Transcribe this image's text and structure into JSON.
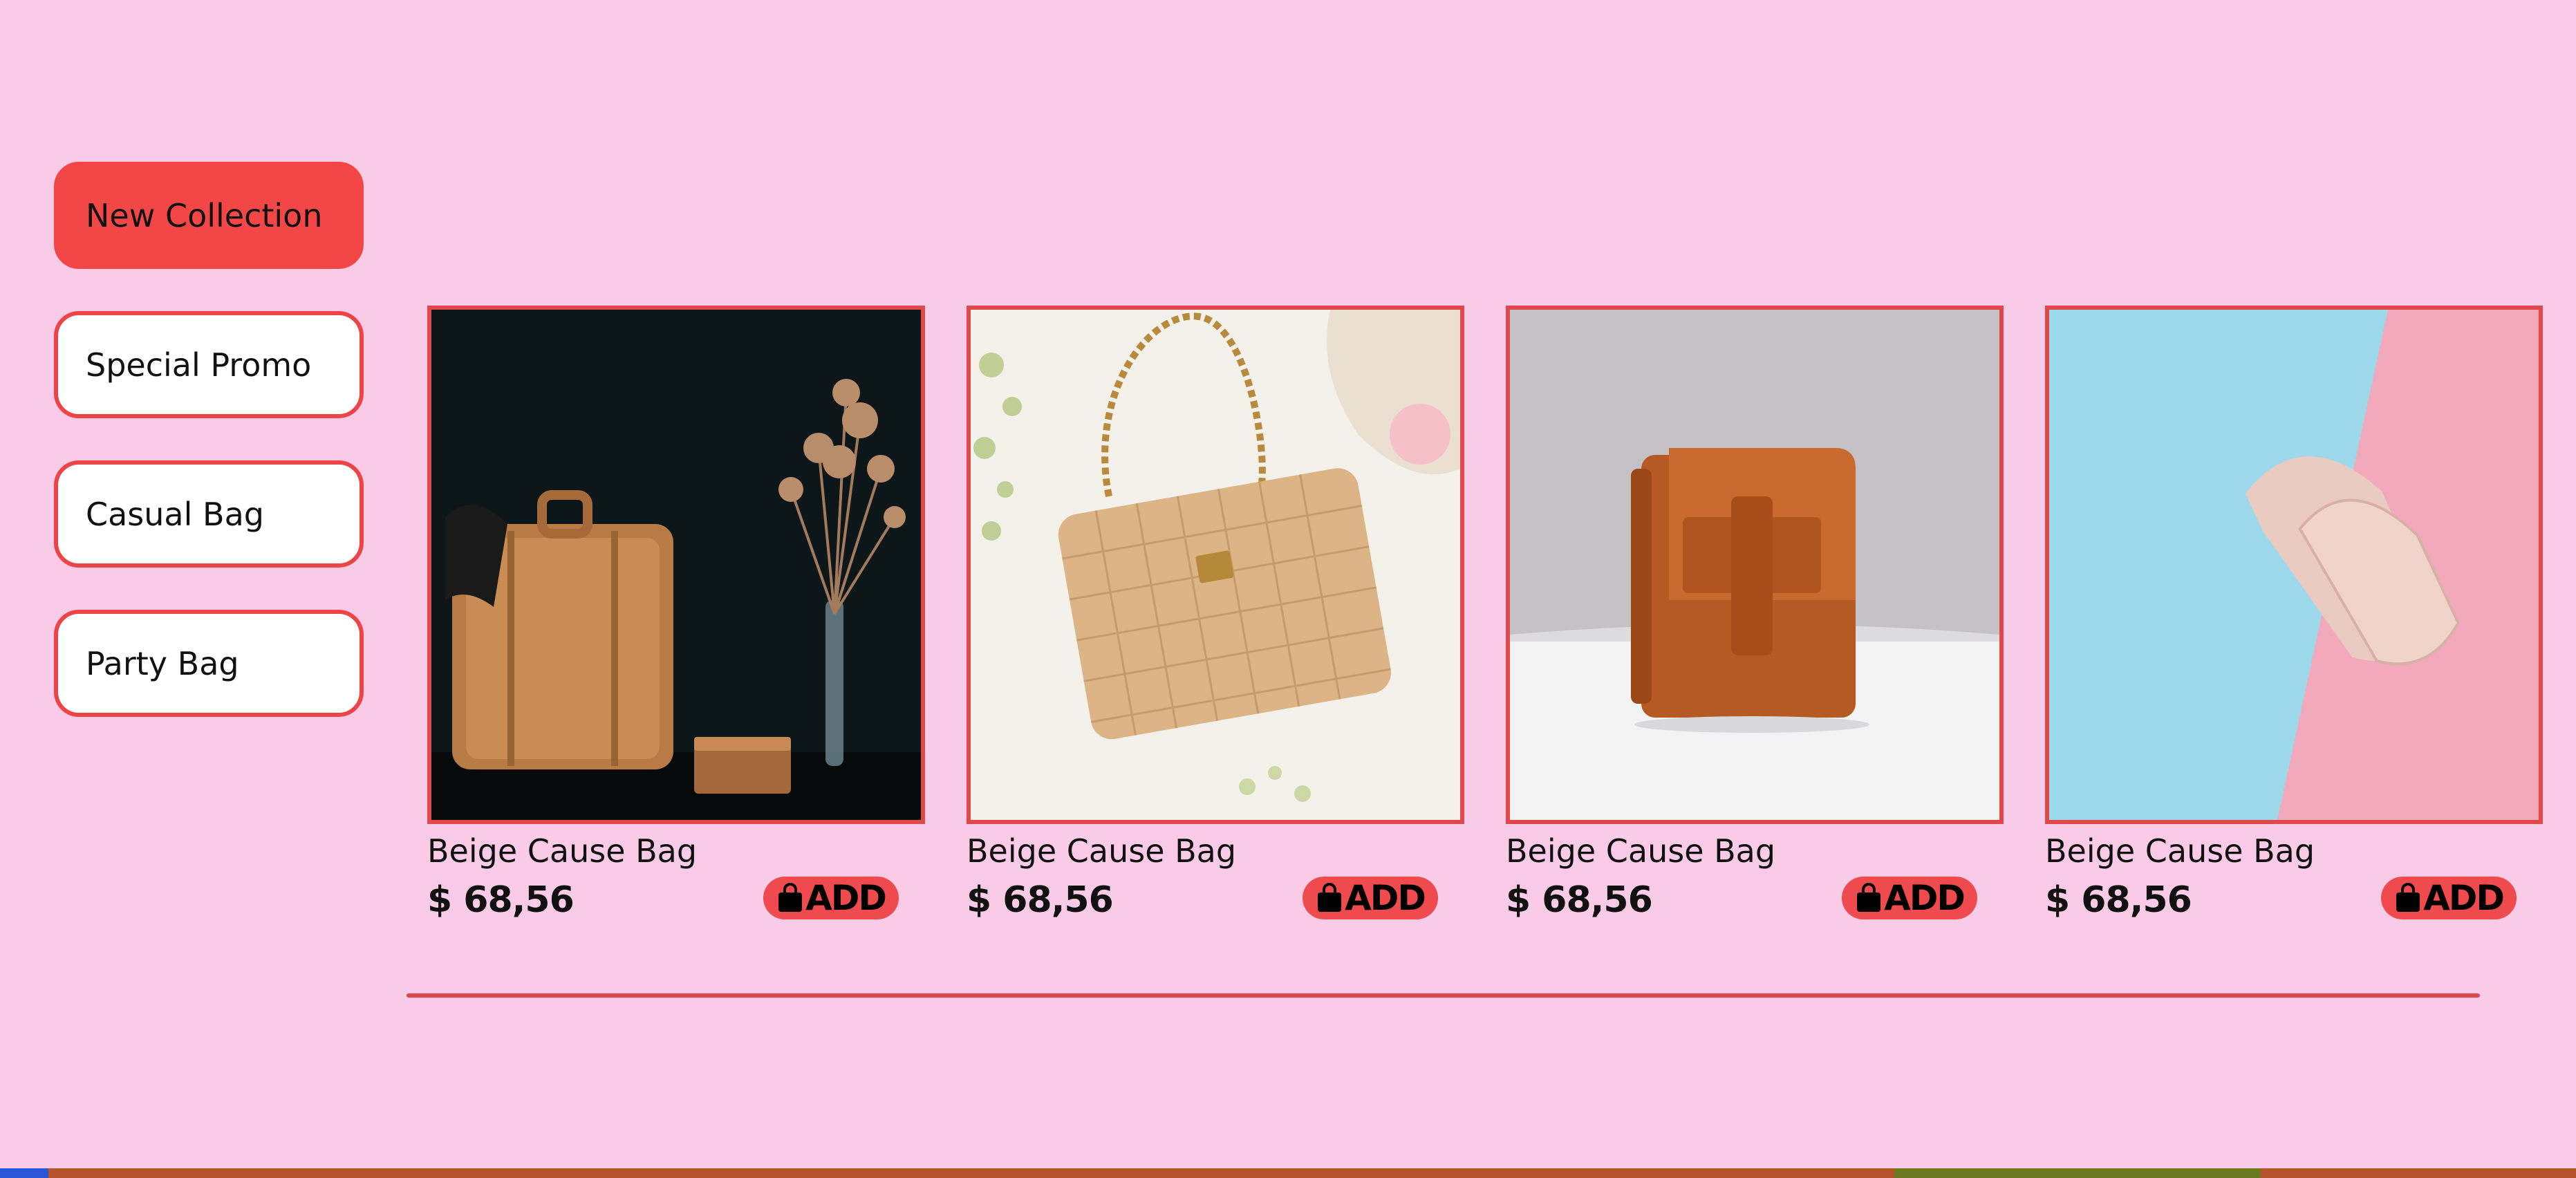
{
  "categories": [
    {
      "label": "New Collection",
      "active": true
    },
    {
      "label": "Special Promo",
      "active": false
    },
    {
      "label": "Casual Bag",
      "active": false
    },
    {
      "label": "Party Bag",
      "active": false
    }
  ],
  "products": [
    {
      "name": "Beige Cause Bag",
      "price": "$ 68,56",
      "add_label": "ADD"
    },
    {
      "name": "Beige Cause Bag",
      "price": "$ 68,56",
      "add_label": "ADD"
    },
    {
      "name": "Beige Cause Bag",
      "price": "$ 68,56",
      "add_label": "ADD"
    },
    {
      "name": "Beige Cause Bag",
      "price": "$ 68,56",
      "add_label": "ADD"
    }
  ],
  "colors": {
    "background": "#f9cbe7",
    "accent": "#f24647",
    "border": "#e0474a"
  },
  "icons": {
    "add_button": "shopping-bag-icon"
  }
}
